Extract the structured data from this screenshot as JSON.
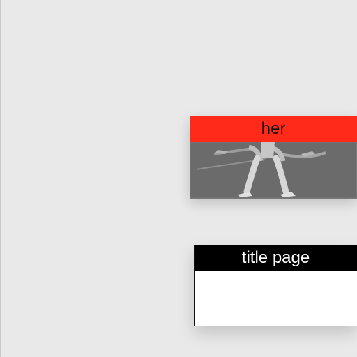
{
  "cards": [
    {
      "label": "her",
      "header_color": "#ff2a1a",
      "image_desc_icon": "figure-image"
    },
    {
      "label": "title page",
      "header_color": "#000000",
      "body_color": "#ffffff"
    }
  ]
}
